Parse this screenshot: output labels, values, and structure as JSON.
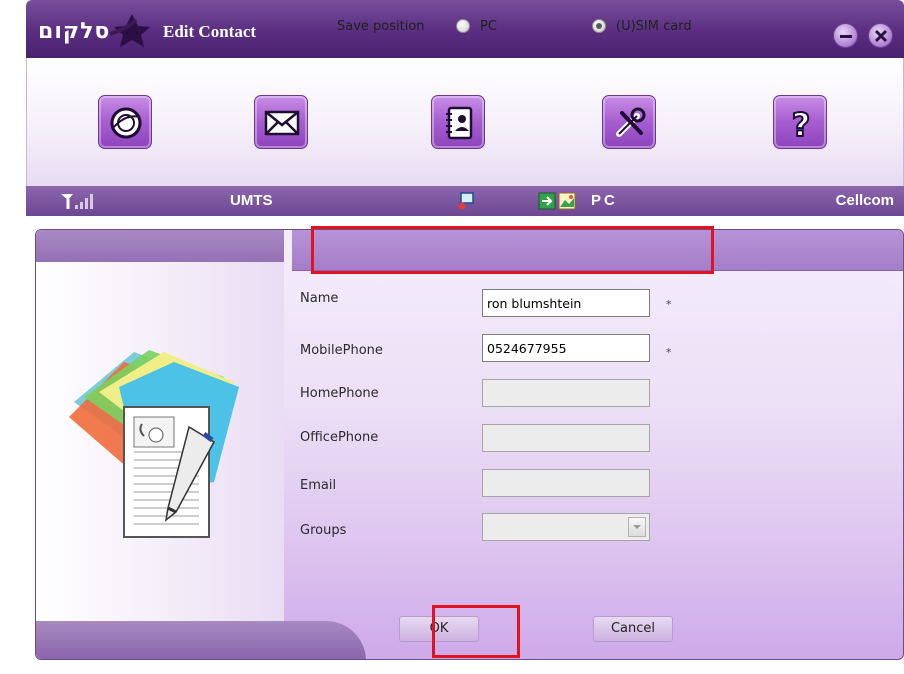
{
  "window": {
    "title": "Edit Contact",
    "logo_text": "סלקום"
  },
  "toolbar": {
    "buttons": [
      {
        "id": "internet",
        "icon": "globe-icon"
      },
      {
        "id": "sms",
        "icon": "envelope-icon"
      },
      {
        "id": "contacts",
        "icon": "address-book-icon"
      },
      {
        "id": "tools",
        "icon": "tools-icon"
      },
      {
        "id": "help",
        "icon": "question-icon",
        "glyph": "?"
      }
    ]
  },
  "status": {
    "network": "UMTS",
    "mode": "PC",
    "operator": "Cellcom"
  },
  "form": {
    "save_position_label": "Save position",
    "save_options": [
      {
        "label": "PC",
        "checked": false
      },
      {
        "label": "(U)SIM card",
        "checked": true
      }
    ],
    "fields": [
      {
        "label": "Name",
        "value": "ron blumshtein",
        "required": true,
        "enabled": true
      },
      {
        "label": "MobilePhone",
        "value": "0524677955",
        "required": true,
        "enabled": true
      },
      {
        "label": "HomePhone",
        "value": "",
        "required": false,
        "enabled": false
      },
      {
        "label": "OfficePhone",
        "value": "",
        "required": false,
        "enabled": false
      },
      {
        "label": "Email",
        "value": "",
        "required": false,
        "enabled": false
      }
    ],
    "groups_label": "Groups",
    "groups_value": "",
    "required_mark": "*"
  },
  "actions": {
    "ok": "OK",
    "cancel": "Cancel"
  },
  "colors": {
    "title_bar": "#5a2d80",
    "accent": "#a65dd0",
    "highlight": "#e0141e"
  }
}
